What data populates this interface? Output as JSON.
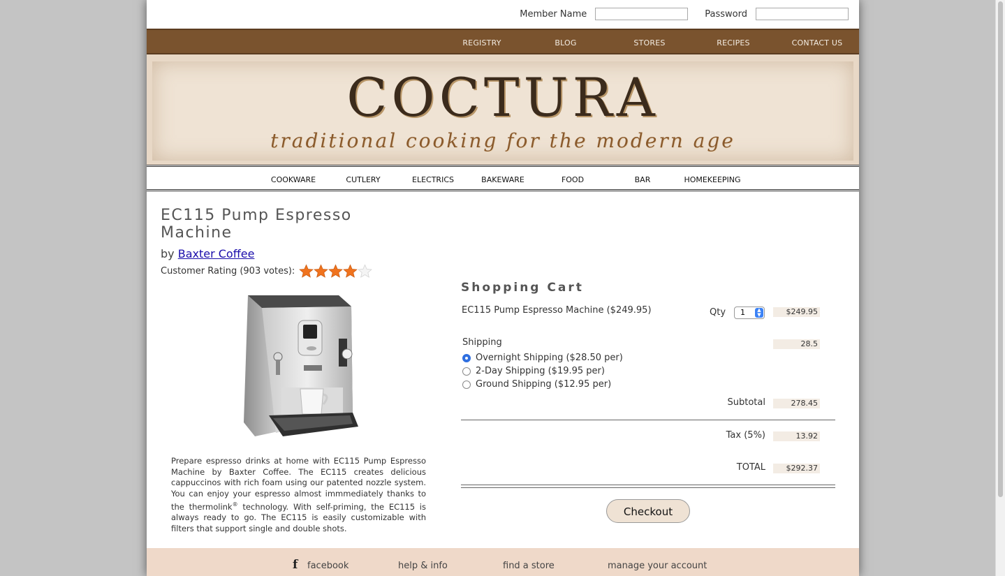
{
  "login": {
    "member_label": "Member Name",
    "member_value": "",
    "password_label": "Password",
    "password_value": ""
  },
  "topnav": [
    "REGISTRY",
    "BLOG",
    "STORES",
    "RECIPES",
    "CONTACT US"
  ],
  "banner": {
    "brand": "COCTURA",
    "tagline": "traditional cooking for the modern age"
  },
  "categories": [
    "COOKWARE",
    "CUTLERY",
    "ELECTRICS",
    "BAKEWARE",
    "FOOD",
    "BAR",
    "HOMEKEEPING"
  ],
  "product": {
    "title": "EC115 Pump Espresso Machine",
    "by": "by",
    "brand": "Baxter Coffee",
    "rating_label": "Customer Rating (903 votes):",
    "rating_value": 4,
    "rating_max": 5,
    "description_1": "Prepare espresso drinks at home with EC115 Pump Espresso Machine by Baxter Coffee. The EC115 creates delicious cappuccinos with rich foam using our patented nozzle system. You can enjoy your espresso almost immmediately thanks to the thermolink",
    "description_sup": "®",
    "description_2": " technology. With self-priming, the EC115 is always ready to go. The EC115 is easily customizable with filters that support single and double shots."
  },
  "cart": {
    "title": "Shopping Cart",
    "item_name": "EC115 Pump Espresso Machine ($249.95)",
    "qty_label": "Qty",
    "qty_value": "1",
    "item_amount": "$249.95",
    "shipping_label": "Shipping",
    "shipping_amount": "28.5",
    "shipping_options": [
      {
        "label": "Overnight Shipping ($28.50 per)",
        "selected": true
      },
      {
        "label": "2-Day Shipping ($19.95 per)",
        "selected": false
      },
      {
        "label": "Ground Shipping ($12.95 per)",
        "selected": false
      }
    ],
    "subtotal_label": "Subtotal",
    "subtotal_amount": "278.45",
    "tax_label": "Tax (5%)",
    "tax_amount": "13.92",
    "total_label": "TOTAL",
    "total_amount": "$292.37",
    "checkout_label": "Checkout"
  },
  "footer": {
    "facebook": "facebook",
    "help": "help & info",
    "store": "find a store",
    "account": "manage your account"
  },
  "colors": {
    "nav_brown": "#7a532e",
    "star_orange": "#f0731e",
    "footer_bg": "#efd9c9",
    "amount_bg": "#f3ece4"
  }
}
